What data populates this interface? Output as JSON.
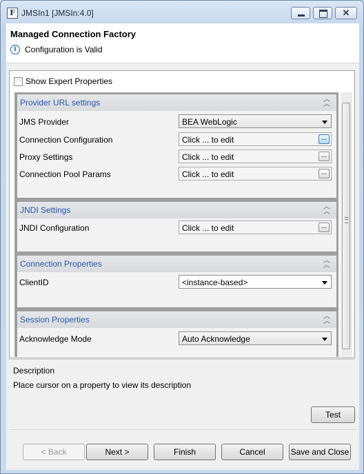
{
  "window": {
    "title": "JMSIn1 [JMSIn:4.0]",
    "app_icon": "F"
  },
  "header": {
    "title": "Managed Connection Factory",
    "status": "Configuration is Valid"
  },
  "expert": {
    "label": "Show Expert Properties",
    "checked": false
  },
  "sections": [
    {
      "title": "Provider URL settings",
      "rows": [
        {
          "label": "JMS Provider",
          "value": "BEA WebLogic",
          "kind": "select"
        },
        {
          "label": "Connection Configuration",
          "value": "Click ... to edit",
          "kind": "edit"
        },
        {
          "label": "Proxy Settings",
          "value": "Click ... to edit",
          "kind": "edit"
        },
        {
          "label": "Connection Pool Params",
          "value": "Click ... to edit",
          "kind": "edit"
        }
      ]
    },
    {
      "title": "JNDI Settings",
      "rows": [
        {
          "label": "JNDI Configuration",
          "value": "Click ... to edit",
          "kind": "edit"
        }
      ]
    },
    {
      "title": "Connection Properties",
      "rows": [
        {
          "label": "ClientID",
          "value": "<instance-based>",
          "kind": "select"
        }
      ]
    },
    {
      "title": "Session Properties",
      "rows": [
        {
          "label": "Acknowledge Mode",
          "value": "Auto Acknowledge",
          "kind": "select"
        }
      ]
    }
  ],
  "ellipsis_label": "...",
  "description": {
    "title": "Description",
    "text": "Place cursor on a property to view its description"
  },
  "buttons": {
    "test": "Test",
    "back": "< Back",
    "next": "Next >",
    "finish": "Finish",
    "cancel": "Cancel",
    "save_close": "Save and Close"
  },
  "colors": {
    "section_title": "#2757a7",
    "info_icon": "#1f5fbf"
  }
}
